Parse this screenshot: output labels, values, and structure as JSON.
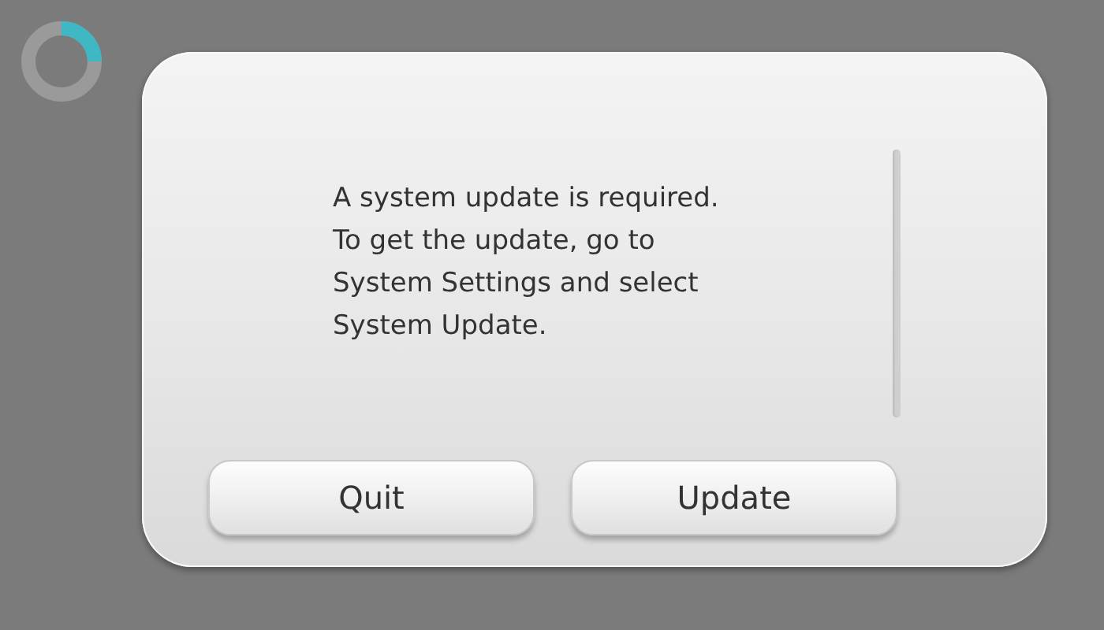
{
  "dialog": {
    "message_lines": [
      "A system update is required.",
      "To get the update, go to",
      "System Settings and select",
      "System Update."
    ],
    "buttons": [
      {
        "label": "Quit"
      },
      {
        "label": "Update"
      }
    ]
  }
}
